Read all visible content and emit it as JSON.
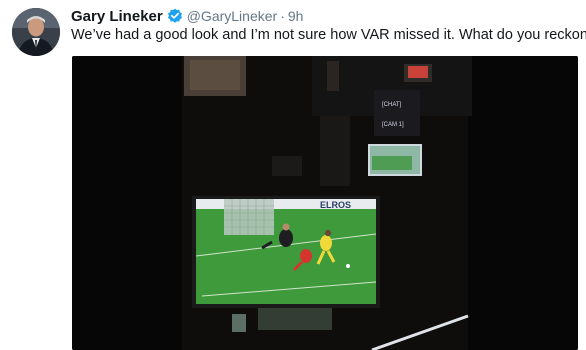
{
  "tweet": {
    "author": {
      "display_name": "Gary Lineker",
      "handle": "@GaryLineker",
      "verified": true
    },
    "separator": "·",
    "timestamp": "9h",
    "text": "We’ve had a good look and I’m not sure how VAR missed it. What do you reckon?"
  },
  "media": {
    "type": "video",
    "monitor_labels": [
      "[CHAT]",
      "[CAM 1]"
    ],
    "board_text": "ELROS"
  },
  "colors": {
    "verified_blue": "#1da1f2",
    "secondary_text": "#657786",
    "primary_text": "#14171a",
    "pitch_green": "#3f9a3c"
  },
  "icons": {
    "verified": "verified-badge-icon"
  }
}
